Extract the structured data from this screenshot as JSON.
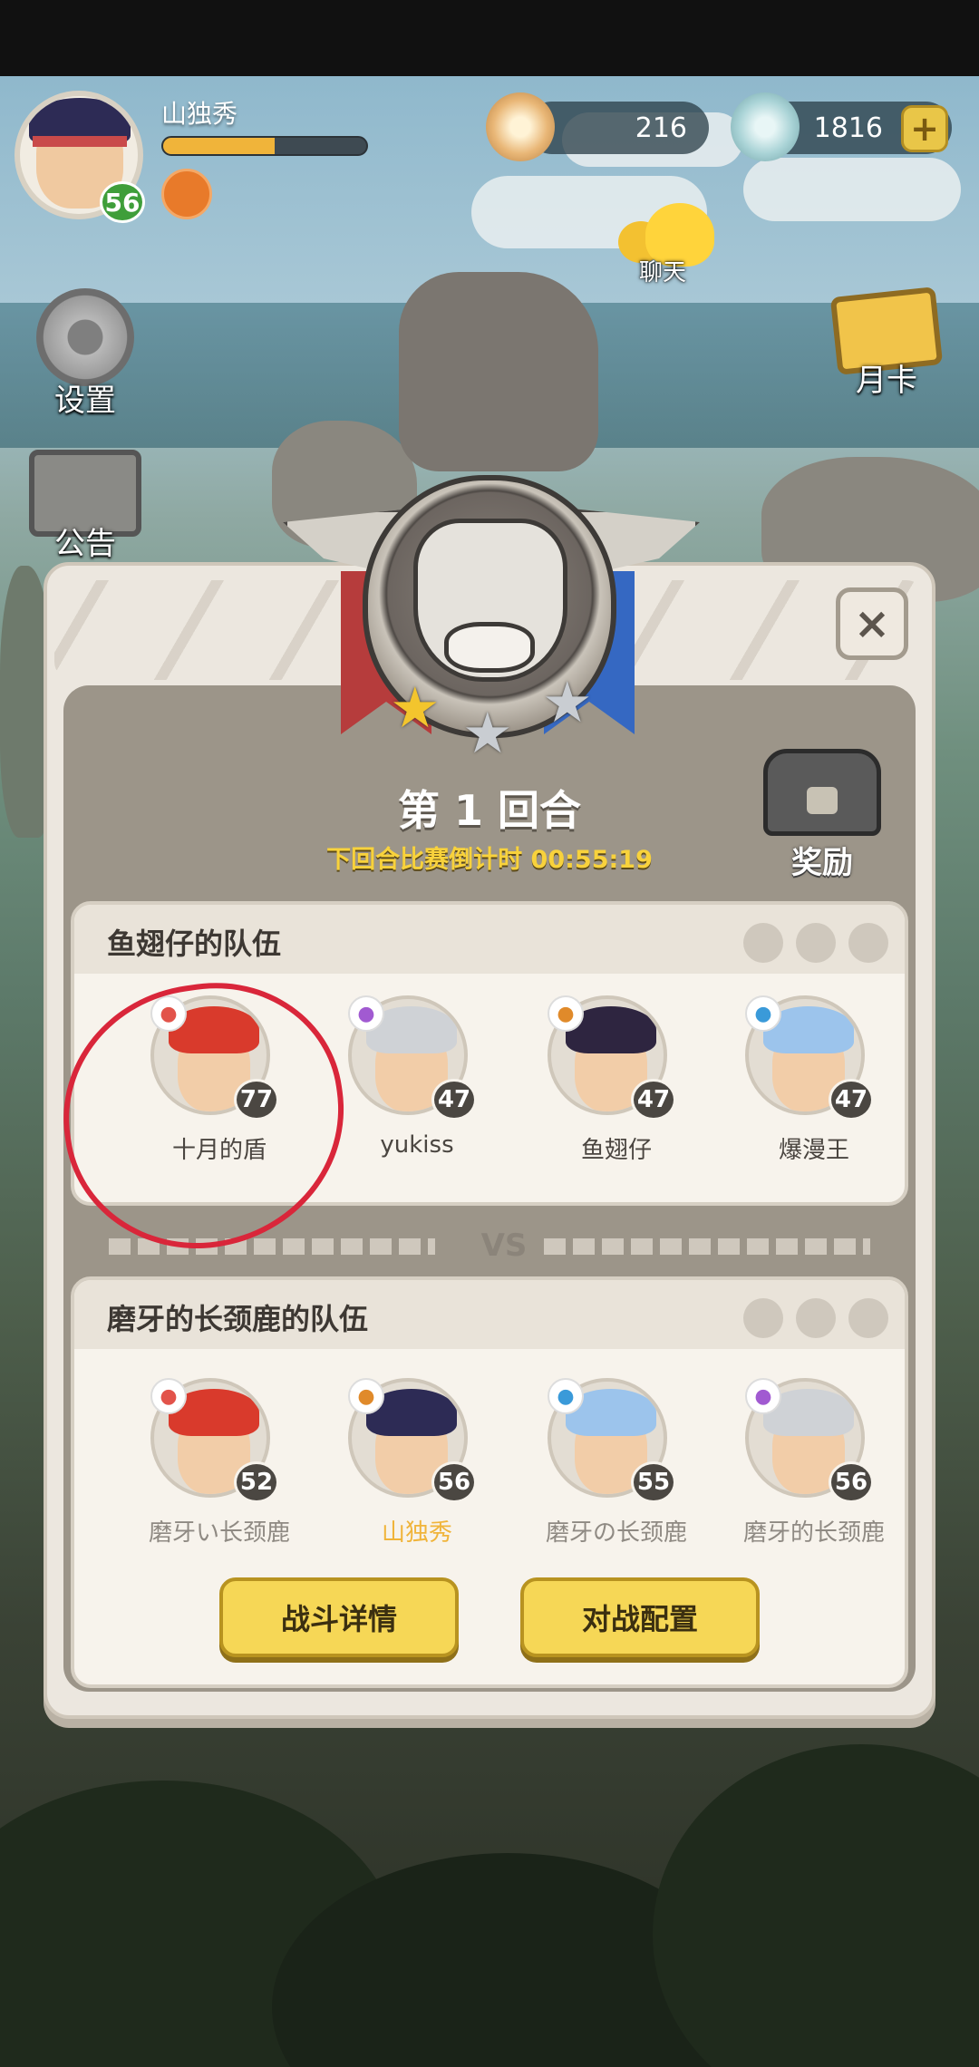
{
  "player": {
    "name": "山独秀",
    "level": "56",
    "xp_fraction": 0.55
  },
  "resources": {
    "shells": "216",
    "gems": "1816",
    "plus_label": "+"
  },
  "hud": {
    "chat_label": "聊天",
    "settings_label": "设置",
    "notice_label": "公告",
    "month_card_label": "月卡"
  },
  "round": {
    "title": "第 1 回合",
    "countdown": "下回合比赛倒计时 00:55:19",
    "reward_label": "奖励",
    "close_label": "×"
  },
  "team_a": {
    "title": "鱼翅仔的队伍",
    "members": [
      {
        "name": "十月的盾",
        "level": "77",
        "hair": "#d93a2c",
        "class_icon": "fire-icon",
        "class_color": "#e2534a",
        "highlight": true
      },
      {
        "name": "yukiss",
        "level": "47",
        "hair": "#cfd2d6",
        "class_icon": "swirl-icon",
        "class_color": "#a15ad1"
      },
      {
        "name": "鱼翅仔",
        "level": "47",
        "hair": "#2e2540",
        "class_icon": "sword-icon",
        "class_color": "#e08a2a"
      },
      {
        "name": "爆漫王",
        "level": "47",
        "hair": "#9cc4ec",
        "class_icon": "blade-icon",
        "class_color": "#3a9ad9"
      }
    ]
  },
  "vs_label": "VS",
  "team_b": {
    "title": "磨牙的长颈鹿的队伍",
    "members": [
      {
        "name": "磨牙い长颈鹿",
        "level": "52",
        "hair": "#d93a2c",
        "class_icon": "fire-icon",
        "class_color": "#e2534a"
      },
      {
        "name": "山独秀",
        "level": "56",
        "hair": "#2d2b55",
        "class_icon": "trident-icon",
        "class_color": "#e08a2a",
        "self": true
      },
      {
        "name": "磨牙の长颈鹿",
        "level": "55",
        "hair": "#9cc4ec",
        "class_icon": "wave-icon",
        "class_color": "#3a9ad9"
      },
      {
        "name": "磨牙的长颈鹿",
        "level": "56",
        "hair": "#cfd2d6",
        "class_icon": "swirl-icon",
        "class_color": "#a15ad1"
      }
    ]
  },
  "buttons": {
    "battle_details": "战斗详情",
    "battle_config": "对战配置"
  },
  "colors": {
    "accent_yellow": "#f6d756",
    "countdown": "#f8d23c",
    "self_name": "#f0b43a",
    "annotation": "#d9263a"
  }
}
